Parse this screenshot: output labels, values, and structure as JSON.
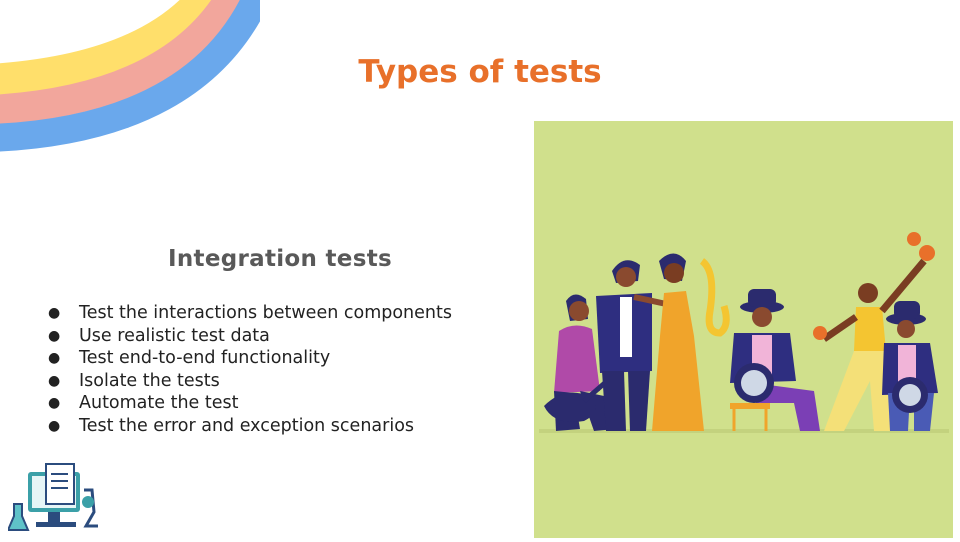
{
  "slide": {
    "title": "Types of tests",
    "subtitle": "Integration  tests",
    "bullets": [
      "Test the interactions between components",
      "Use realistic test data",
      "Test end-to-end functionality",
      "Isolate the tests",
      "Automate the test",
      "Test the error and exception scenarios"
    ],
    "bullet_glyph": "●"
  },
  "colors": {
    "title": "#e8702a",
    "subtitle": "#595959",
    "illustration_bg": "#d0e08c",
    "rainbow": [
      "#ffdf6b",
      "#f2a69c",
      "#6aa8ec"
    ]
  },
  "icons": {
    "decoration": "rainbow-decoration",
    "illustration": "musicians-band-illustration",
    "lab": "lab-computer-icon"
  }
}
